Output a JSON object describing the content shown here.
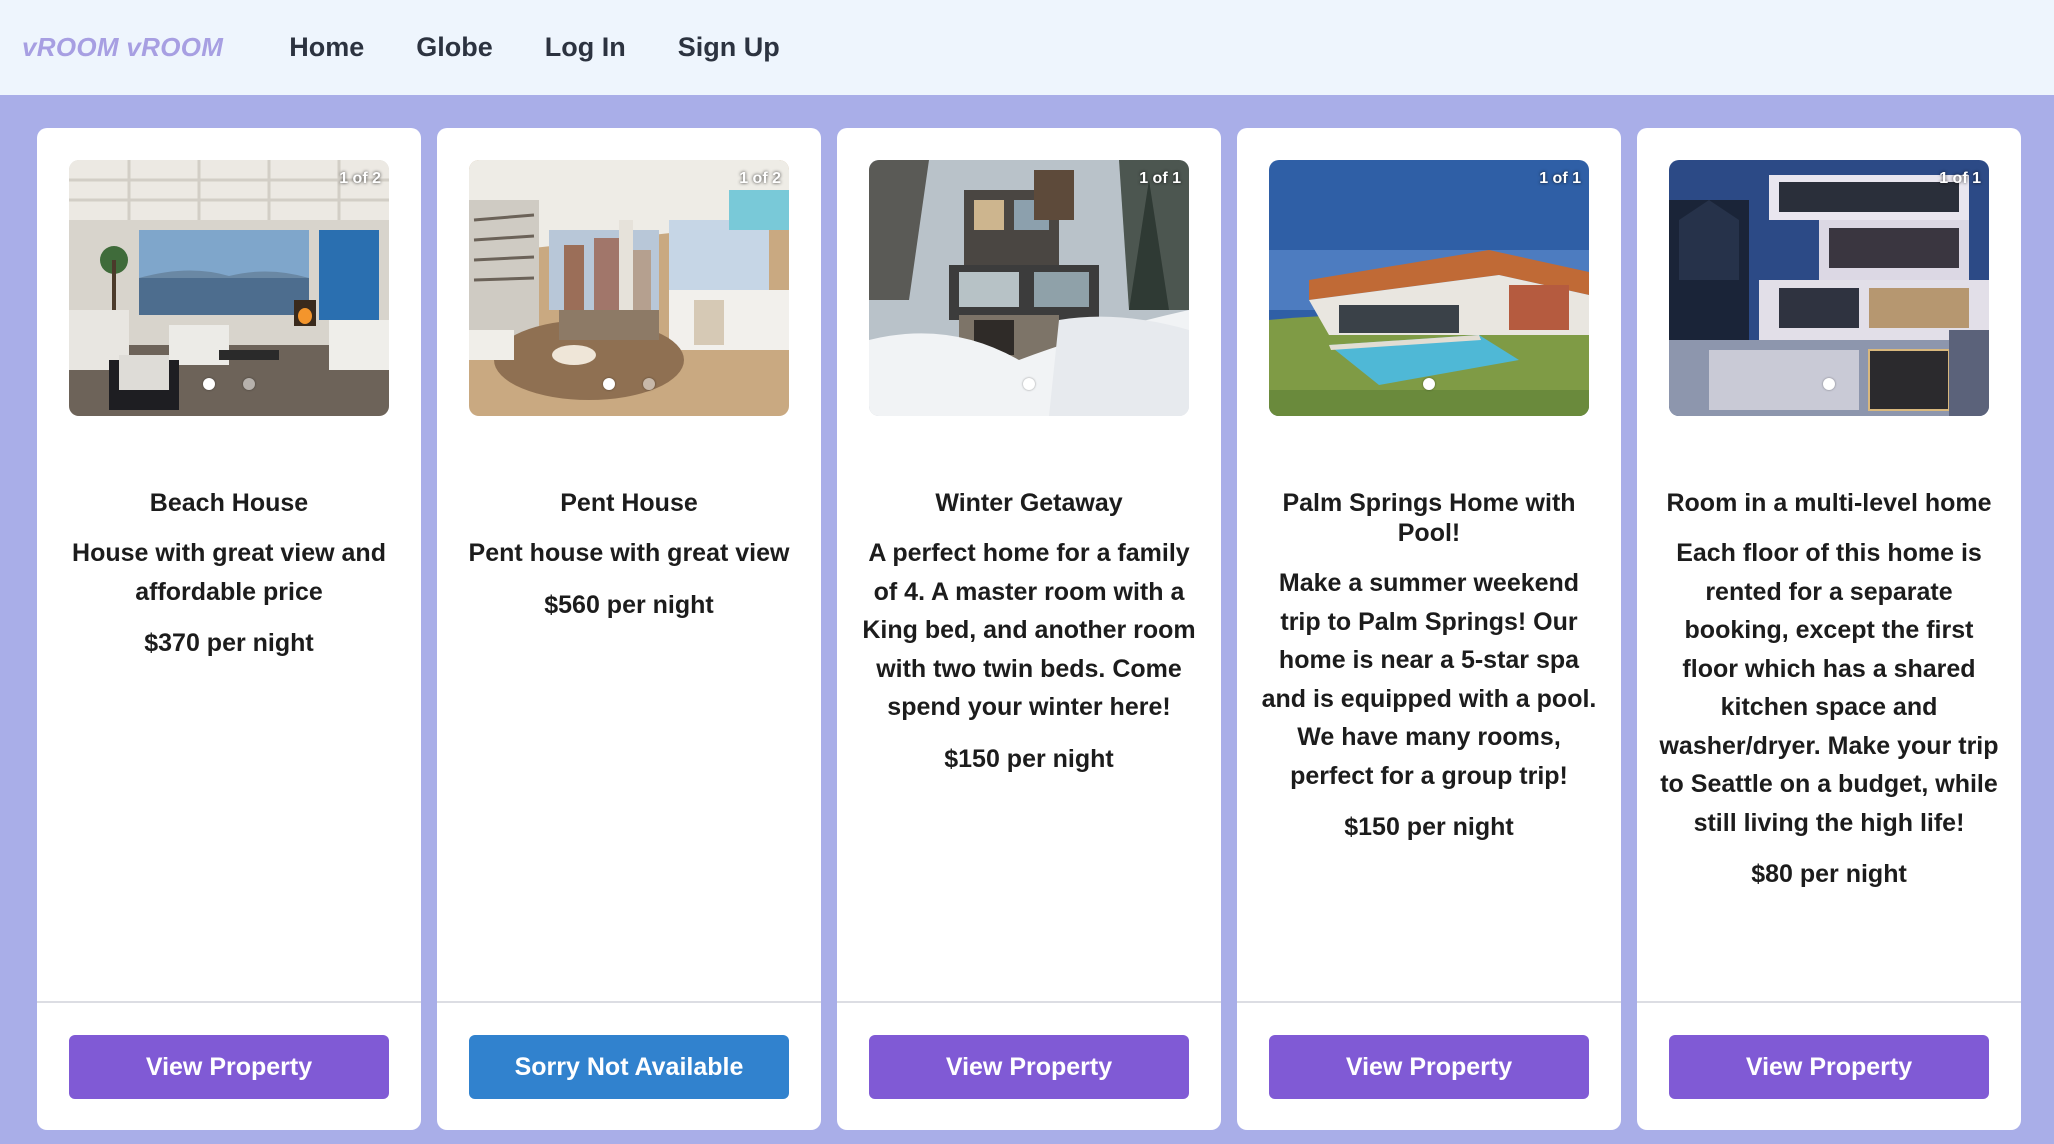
{
  "navbar": {
    "brand": "vROOM vROOM",
    "links": [
      "Home",
      "Globe",
      "Log In",
      "Sign Up"
    ]
  },
  "colors": {
    "page_background": "#a9aee8",
    "navbar_background": "#eef5fd",
    "brand": "#a79fe2",
    "button_view": "#805ad5",
    "button_unavailable": "#3182ce"
  },
  "cards": [
    {
      "title": "Beach House",
      "description": "House with great view and affordable price",
      "price": "$370 per night",
      "image_counter": "1 of 2",
      "image_count": 2,
      "active_image": 1,
      "button_label": "View Property",
      "button_color": "#805ad5",
      "image_subject": "beach-house-living-room"
    },
    {
      "title": "Pent House",
      "description": "Pent house with great view",
      "price": "$560 per night",
      "image_counter": "1 of 2",
      "image_count": 2,
      "active_image": 1,
      "button_label": "Sorry Not Available",
      "button_color": "#3182ce",
      "image_subject": "penthouse-living-room"
    },
    {
      "title": "Winter Getaway",
      "description": "A perfect home for a family of 4. A master room with a King bed, and another room with two twin beds. Come spend your winter here!",
      "price": "$150 per night",
      "image_counter": "1 of 1",
      "image_count": 1,
      "active_image": 1,
      "button_label": "View Property",
      "button_color": "#805ad5",
      "image_subject": "snowy-modern-house"
    },
    {
      "title": "Palm Springs Home with Pool!",
      "description": "Make a summer weekend trip to Palm Springs! Our home is near a 5-star spa and is equipped with a pool. We have many rooms, perfect for a group trip!",
      "price": "$150 per night",
      "image_counter": "1 of 1",
      "image_count": 1,
      "active_image": 1,
      "button_label": "View Property",
      "button_color": "#805ad5",
      "image_subject": "modern-house-with-pool"
    },
    {
      "title": "Room in a multi-level home",
      "description": "Each floor of this home is rented for a separate booking, except the first floor which has a shared kitchen space and washer/dryer. Make your trip to Seattle on a budget, while still living the high life!",
      "price": "$80 per night",
      "image_counter": "1 of 1",
      "image_count": 1,
      "active_image": 1,
      "button_label": "View Property",
      "button_color": "#805ad5",
      "image_subject": "multi-level-house-at-dusk"
    }
  ]
}
